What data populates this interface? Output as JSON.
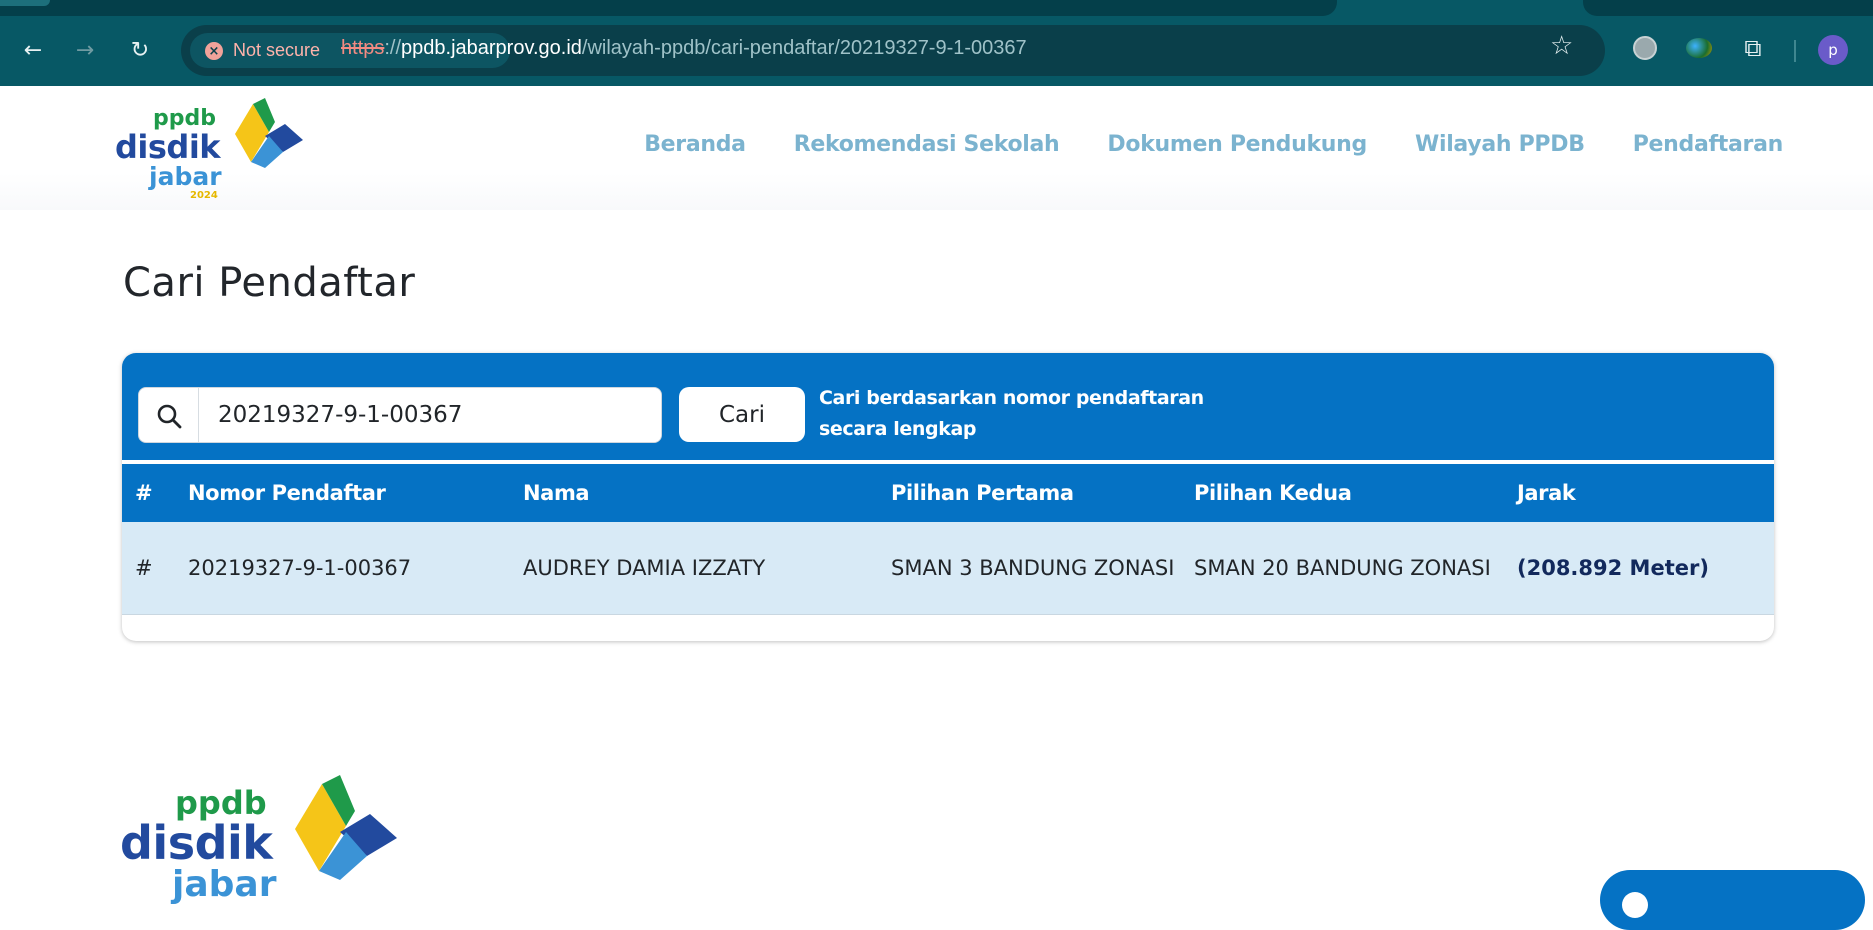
{
  "browser": {
    "security_label": "Not secure",
    "url_scheme": "https",
    "url_sep": "://",
    "url_host": "ppdb.jabarprov.go.id",
    "url_path": "/wilayah-ppdb/cari-pendaftar/20219327-9-1-00367",
    "profile_initial": "p",
    "icons": [
      "back-icon",
      "forward-icon",
      "reload-icon",
      "not-secure-icon",
      "star-icon",
      "globe-icon",
      "extension-orb-icon",
      "puzzle-icon",
      "profile-avatar"
    ]
  },
  "site": {
    "logo": {
      "line1": "ppdb",
      "line2": "disdik",
      "line3": "jabar",
      "year": "2024"
    },
    "nav": [
      "Beranda",
      "Rekomendasi Sekolah",
      "Dokumen Pendukung",
      "Wilayah PPDB",
      "Pendaftaran"
    ]
  },
  "main": {
    "title": "Cari Pendaftar",
    "search": {
      "value": "20219327-9-1-00367",
      "button_label": "Cari",
      "hint": "Cari berdasarkan nomor pendaftaran secara lengkap"
    },
    "table": {
      "headers": [
        "#",
        "Nomor Pendaftar",
        "Nama",
        "Pilihan Pertama",
        "Pilihan Kedua",
        "Jarak"
      ],
      "rows": [
        {
          "index": "#",
          "nomor": "20219327-9-1-00367",
          "nama": "AUDREY DAMIA IZZATY",
          "pilihan_pertama": "SMAN 3 BANDUNG ZONASI",
          "pilihan_kedua": "SMAN 20 BANDUNG ZONASI",
          "jarak": "(208.892 Meter)"
        }
      ]
    }
  },
  "footer": {
    "logo": {
      "line1": "ppdb",
      "line2": "disdik",
      "line3": "jabar"
    }
  },
  "colors": {
    "brand_blue": "#0572c4",
    "row_bg": "#d8eaf6",
    "nav_text": "#7bb3cf",
    "chrome_bg": "#075865"
  }
}
